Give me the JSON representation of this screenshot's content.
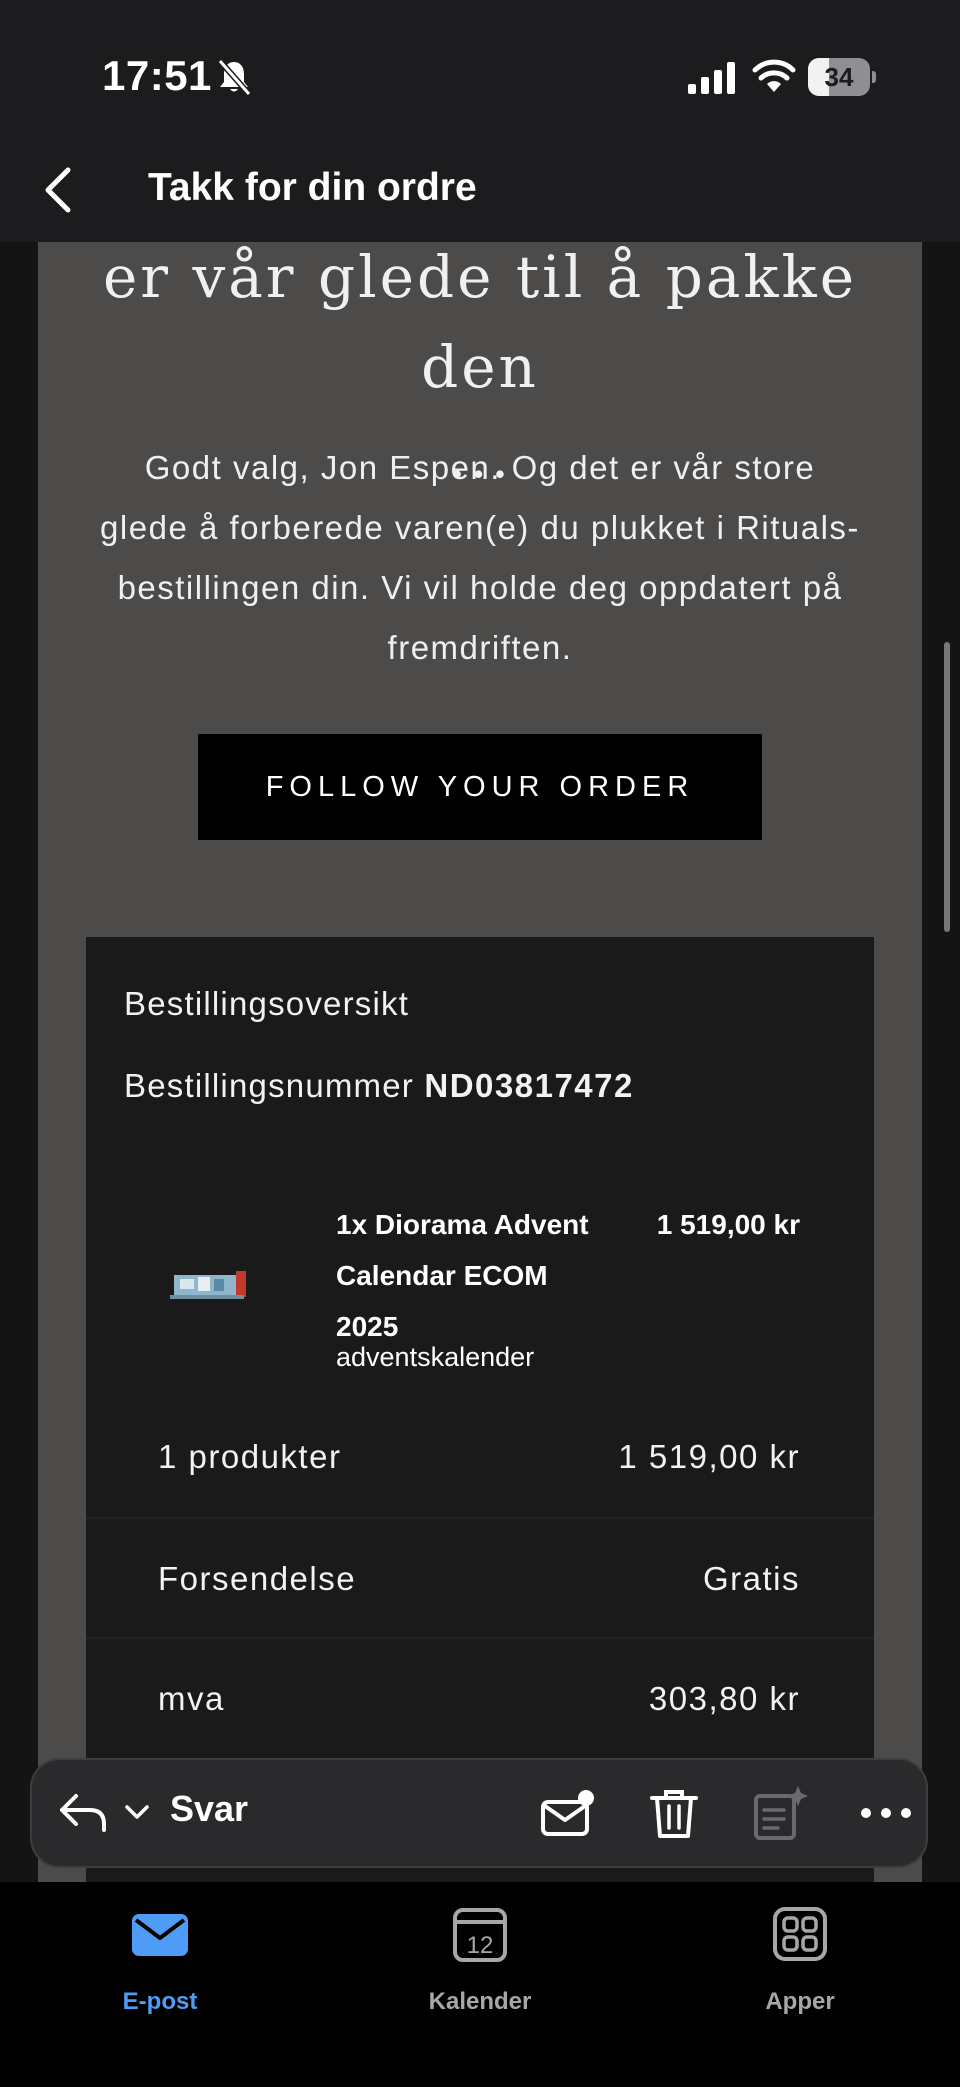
{
  "status_bar": {
    "time": "17:51",
    "battery_level": "34"
  },
  "nav": {
    "title": "Takk for din ordre"
  },
  "email": {
    "headline_line1": "er vår glede til å pakke den",
    "headline_line2": "...",
    "intro_text": "Godt valg, Jon Espen. Og det er vår store glede å forberede varen(e) du plukket i Rituals-bestillingen din. Vi vil holde deg oppdatert på fremdriften.",
    "follow_button": "FOLLOW YOUR ORDER",
    "order": {
      "overview_title": "Bestillingsoversikt",
      "number_label": "Bestillingsnummer",
      "number_value": "ND03817472",
      "product": {
        "name": "1x Diorama Advent Calendar ECOM 2025",
        "subtitle": "adventskalender",
        "price": "1 519,00 kr"
      },
      "summary": [
        {
          "label": "1 produkter",
          "value": "1 519,00 kr"
        },
        {
          "label": "Forsendelse",
          "value": "Gratis"
        },
        {
          "label": "mva",
          "value": "303,80 kr"
        }
      ]
    }
  },
  "toolbar": {
    "reply_label": "Svar"
  },
  "tabs": [
    {
      "label": "E-post",
      "icon": "mail-icon",
      "active": true
    },
    {
      "label": "Kalender",
      "icon": "calendar-icon",
      "calendar_day": "12",
      "active": false
    },
    {
      "label": "Apper",
      "icon": "apps-icon",
      "active": false
    }
  ],
  "colors": {
    "accent": "#4f9cf7",
    "inactive_tab": "#a7a7a9",
    "card_bg": "#4c4b4a",
    "order_bg": "#1a1a1a"
  }
}
